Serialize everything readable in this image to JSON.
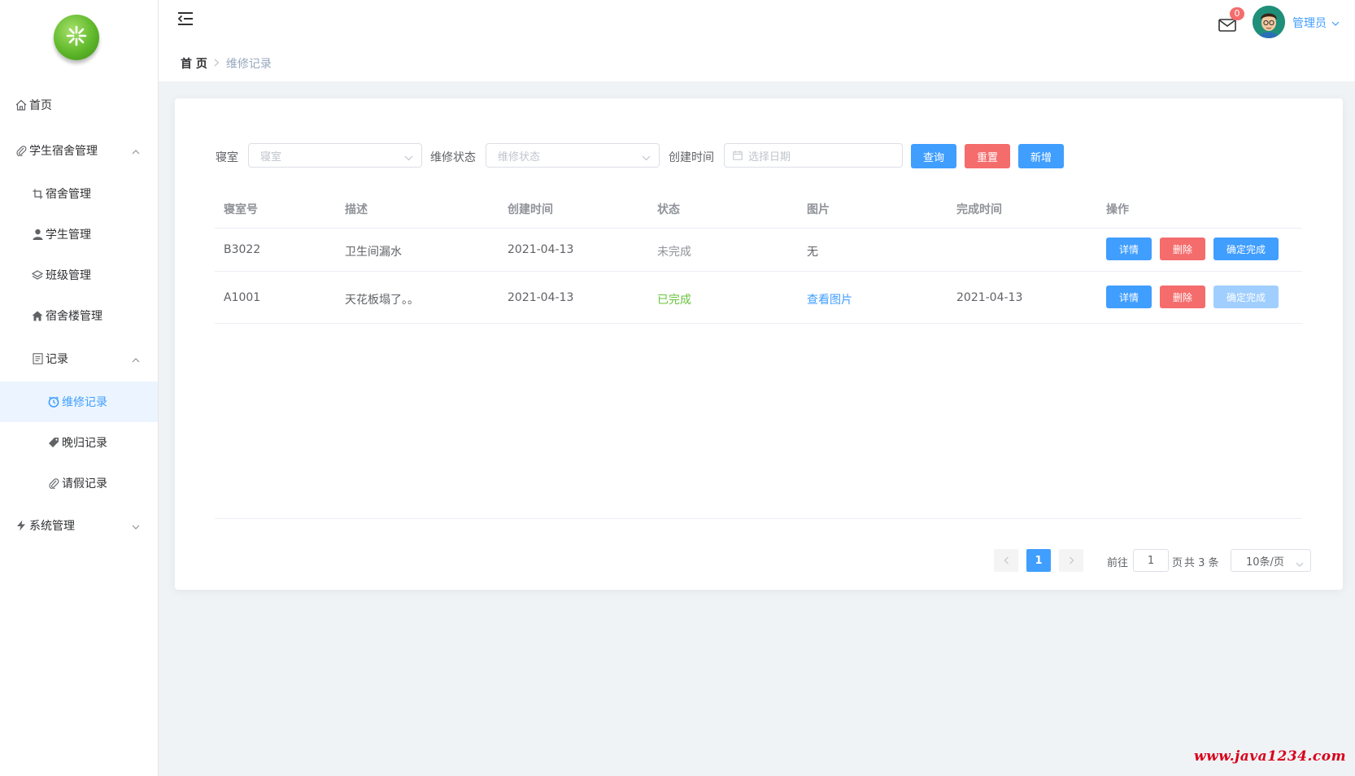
{
  "sidebar": {
    "items": [
      {
        "label": "首页",
        "icon": "home-icon"
      },
      {
        "label": "学生宿舍管理",
        "icon": "paperclip-icon"
      },
      {
        "label": "宿舍管理",
        "icon": "crop-icon"
      },
      {
        "label": "学生管理",
        "icon": "user-icon"
      },
      {
        "label": "班级管理",
        "icon": "layers-icon"
      },
      {
        "label": "宿舍楼管理",
        "icon": "house-icon"
      },
      {
        "label": "记录",
        "icon": "document-icon"
      },
      {
        "label": "维修记录",
        "icon": "clock-icon"
      },
      {
        "label": "晚归记录",
        "icon": "tag-icon"
      },
      {
        "label": "请假记录",
        "icon": "paperclip-icon"
      },
      {
        "label": "系统管理",
        "icon": "lightning-icon"
      }
    ]
  },
  "header": {
    "mail_badge": "0",
    "user_name": "管理员"
  },
  "breadcrumb": {
    "home": "首 页",
    "current": "维修记录"
  },
  "filters": {
    "room_label": "寝室",
    "room_placeholder": "寝室",
    "status_label": "维修状态",
    "status_placeholder": "维修状态",
    "created_label": "创建时间",
    "date_placeholder": "选择日期",
    "query_btn": "查询",
    "reset_btn": "重置",
    "add_btn": "新增"
  },
  "table": {
    "headers": [
      "寝室号",
      "描述",
      "创建时间",
      "状态",
      "图片",
      "完成时间",
      "操作"
    ],
    "rows": [
      {
        "room": "B3022",
        "desc": "卫生间漏水",
        "created": "2021-04-13",
        "status": "未完成",
        "image": "无",
        "finished": "",
        "detail": "详情",
        "delete": "删除",
        "confirm": "确定完成"
      },
      {
        "room": "A1001",
        "desc": "天花板塌了。。",
        "created": "2021-04-13",
        "status": "已完成",
        "image": "查看图片",
        "finished": "2021-04-13",
        "detail": "详情",
        "delete": "删除",
        "confirm": "确定完成"
      }
    ]
  },
  "pagination": {
    "current_page": "1",
    "goto_label": "前往",
    "goto_value": "1",
    "page_suffix": "页",
    "total_text": "共 3 条",
    "page_size": "10条/页"
  },
  "colors": {
    "primary": "#409eff",
    "danger": "#f56c6c",
    "success": "#67c23a"
  },
  "watermark": "www.java1234.com"
}
